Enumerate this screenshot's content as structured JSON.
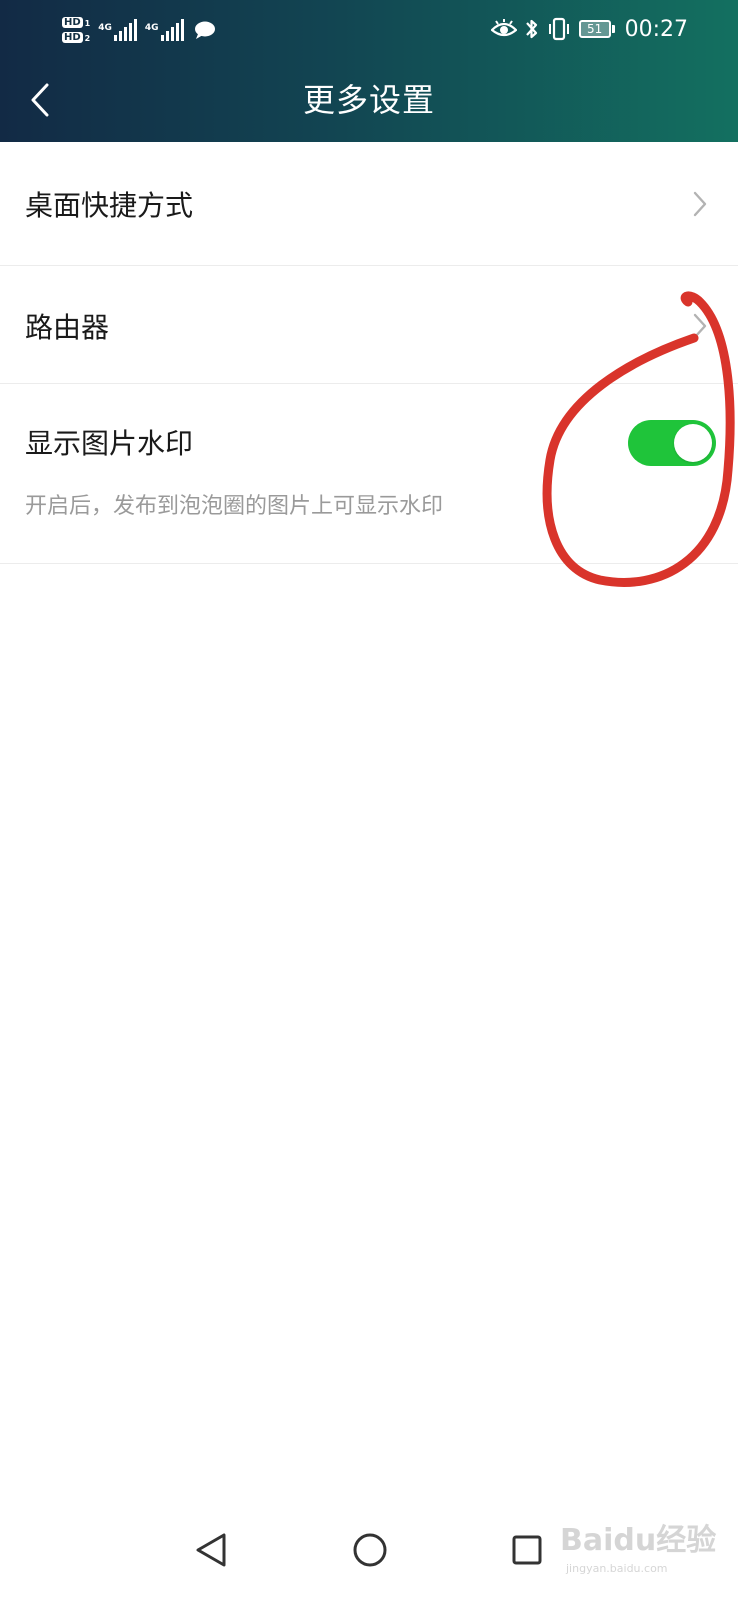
{
  "status_bar": {
    "sim1_label": "HD",
    "sim1_num": "1",
    "sim2_label": "HD",
    "sim2_num": "2",
    "network1": "4G",
    "network2": "4G",
    "icons": [
      "hd-icon",
      "signal-icon",
      "message-icon",
      "eye-comfort-icon",
      "bluetooth-icon",
      "vibrate-icon",
      "battery-icon"
    ],
    "battery_level": "51",
    "time": "00:27"
  },
  "header": {
    "title": "更多设置"
  },
  "settings": {
    "shortcut_label": "桌面快捷方式",
    "router_label": "路由器",
    "watermark_label": "显示图片水印",
    "watermark_desc": "开启后，发布到泡泡圈的图片上可显示水印",
    "watermark_enabled": true
  },
  "colors": {
    "header_gradient_start": "#122a45",
    "header_gradient_end": "#137060",
    "toggle_on": "#1fc43a",
    "annotation": "#d9342b"
  },
  "watermark": {
    "text": "Baidu经验",
    "subtext": "jingyan.baidu.com"
  }
}
